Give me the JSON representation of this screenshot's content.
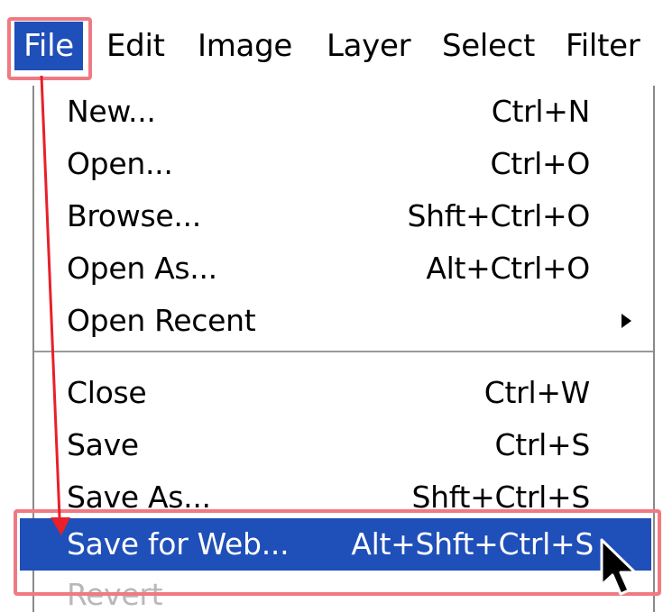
{
  "menubar": {
    "items": [
      {
        "label": "File"
      },
      {
        "label": "Edit"
      },
      {
        "label": "Image"
      },
      {
        "label": "Layer"
      },
      {
        "label": "Select"
      },
      {
        "label": "Filter"
      }
    ]
  },
  "file_menu": {
    "items": [
      {
        "label": "New...",
        "shortcut": "Ctrl+N"
      },
      {
        "label": "Open...",
        "shortcut": "Ctrl+O"
      },
      {
        "label": "Browse...",
        "shortcut": "Shft+Ctrl+O"
      },
      {
        "label": "Open As...",
        "shortcut": "Alt+Ctrl+O"
      },
      {
        "label": "Open Recent",
        "shortcut": ""
      },
      {
        "label": "Close",
        "shortcut": "Ctrl+W"
      },
      {
        "label": "Save",
        "shortcut": "Ctrl+S"
      },
      {
        "label": "Save As...",
        "shortcut": "Shft+Ctrl+S"
      },
      {
        "label": "Save for Web...",
        "shortcut": "Alt+Shft+Ctrl+S"
      },
      {
        "label": "Revert",
        "shortcut": ""
      }
    ]
  },
  "colors": {
    "highlight": "#1f4fb8",
    "annotation": "#f07a82",
    "arrow": "#e8202a",
    "disabled_text": "#b8b8b8"
  },
  "icons": {
    "submenu": "triangle-right-icon",
    "pointer": "mouse-cursor-icon"
  }
}
